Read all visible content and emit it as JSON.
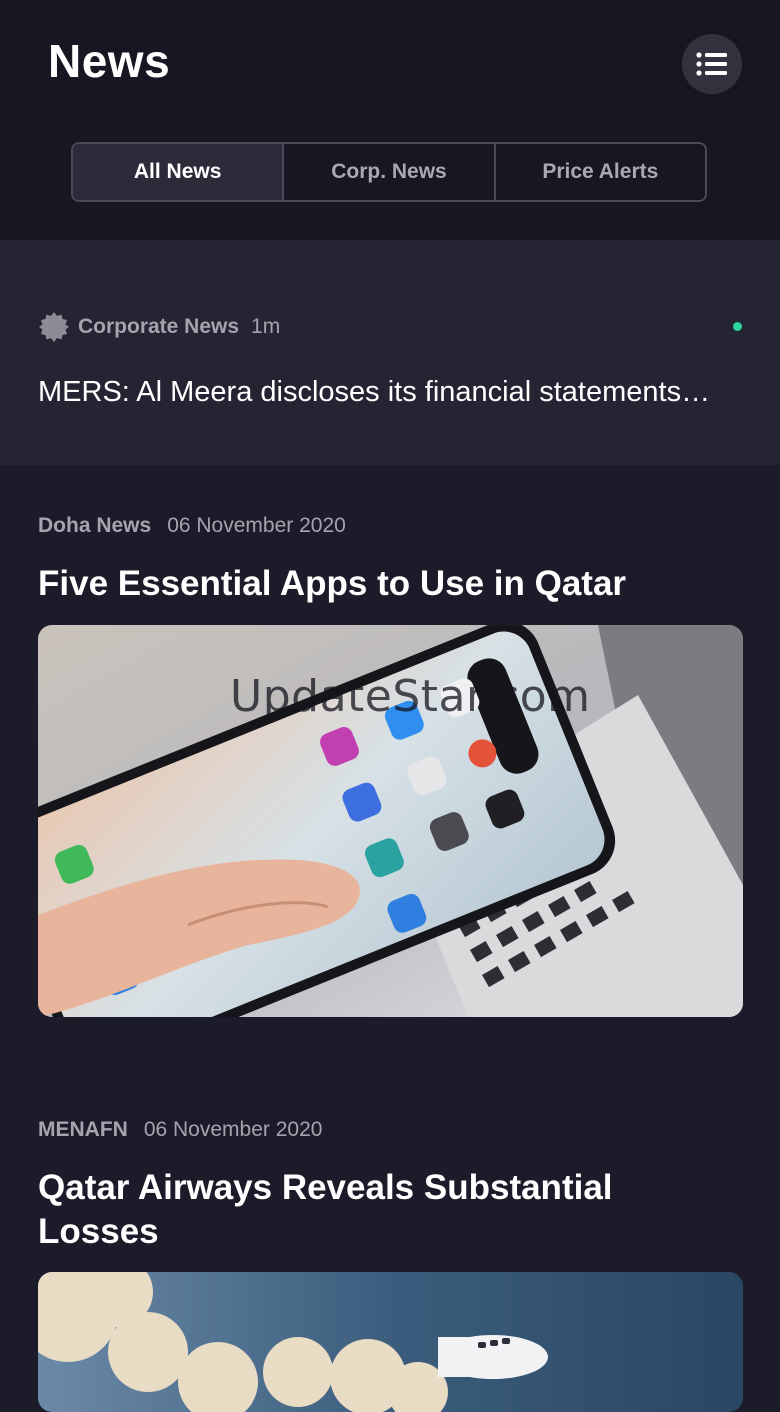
{
  "header": {
    "title": "News",
    "menu_icon": "list-icon"
  },
  "tabs": [
    {
      "label": "All News",
      "active": true
    },
    {
      "label": "Corp. News",
      "active": false
    },
    {
      "label": "Price Alerts",
      "active": false
    }
  ],
  "alert": {
    "icon": "badge-icon",
    "source": "Corporate News",
    "time": "1m",
    "headline": "MERS: Al Meera discloses its financial statements…",
    "unread_color": "#2ed6a0"
  },
  "articles": [
    {
      "source": "Doha News",
      "date": "06 November 2020",
      "title": "Five Essential Apps to Use in Qatar",
      "image": "smartphone-apps-photo",
      "watermark": "UpdateStar.com"
    },
    {
      "source": "MENAFN",
      "date": "06 November 2020",
      "title": "Qatar Airways Reveals Substantial Losses",
      "image": "airplane-clouds-photo"
    }
  ],
  "colors": {
    "background": "#1c1b29",
    "header": "#171622",
    "alert_card": "#252432",
    "accent": "#2ed6a0"
  }
}
